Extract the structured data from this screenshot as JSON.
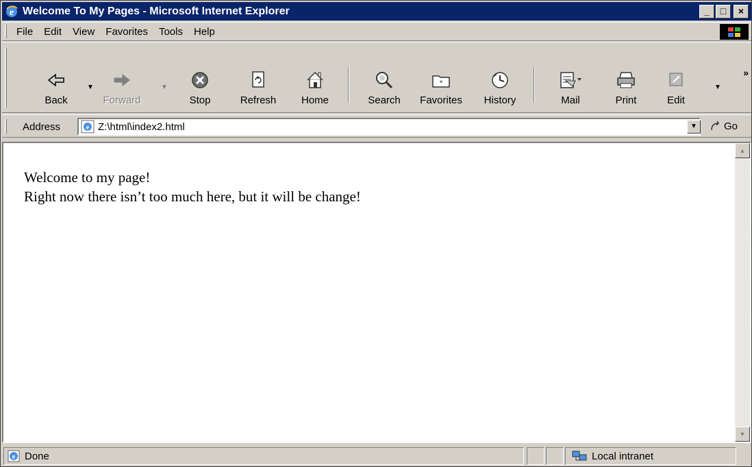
{
  "window": {
    "title": "Welcome To My Pages - Microsoft Internet Explorer",
    "minimize": "_",
    "maximize": "□",
    "close": "×"
  },
  "menu": {
    "items": [
      {
        "label": "File",
        "hotkey": "F"
      },
      {
        "label": "Edit",
        "hotkey": "E"
      },
      {
        "label": "View",
        "hotkey": "V"
      },
      {
        "label": "Favorites",
        "hotkey": "a"
      },
      {
        "label": "Tools",
        "hotkey": "T"
      },
      {
        "label": "Help",
        "hotkey": "H"
      }
    ]
  },
  "toolbar": {
    "back": "Back",
    "forward": "Forward",
    "stop": "Stop",
    "refresh": "Refresh",
    "home": "Home",
    "search": "Search",
    "favorites": "Favorites",
    "history": "History",
    "mail": "Mail",
    "print": "Print",
    "edit": "Edit",
    "more": "»"
  },
  "address": {
    "label": "Address",
    "value": "Z:\\html\\index2.html",
    "go": "Go"
  },
  "page": {
    "line1": "Welcome to my page!",
    "line2": "Right now there isn’t too much here, but it will be change!"
  },
  "status": {
    "text": "Done",
    "zone": "Local intranet"
  },
  "colors": {
    "titlebar": "#0a246a",
    "chrome": "#d4d0c8"
  }
}
